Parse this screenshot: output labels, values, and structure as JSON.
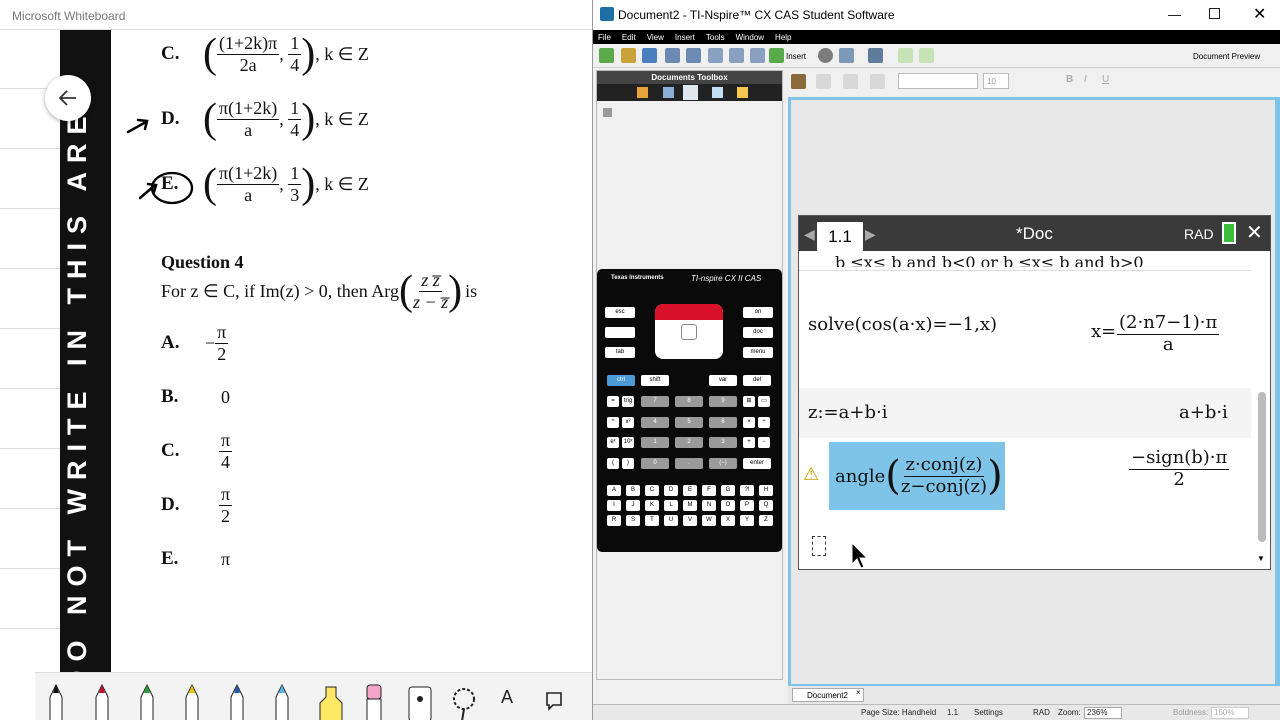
{
  "whiteboard": {
    "title": "Microsoft Whiteboard",
    "band_text": "DO NOT WRITE IN THIS AREA",
    "options_top": [
      {
        "letter": "C.",
        "num": "(1+2k)π",
        "den": "2a",
        "num2": "1",
        "den2": "4",
        "tail": ", k ∈ Z"
      },
      {
        "letter": "D.",
        "num": "π(1+2k)",
        "den": "a",
        "num2": "1",
        "den2": "4",
        "tail": ", k ∈ Z"
      },
      {
        "letter": "E.",
        "num": "π(1+2k)",
        "den": "a",
        "num2": "1",
        "den2": "3",
        "tail": ", k ∈ Z"
      }
    ],
    "question_title": "Question 4",
    "question_pre": "For z ∈ C, if Im(z) > 0, then Arg",
    "question_frac_num": "z z̅",
    "question_frac_den": "z − z̅",
    "question_post": "is",
    "answers": [
      {
        "letter": "A.",
        "prefix": "−",
        "num": "π",
        "den": "2"
      },
      {
        "letter": "B.",
        "value": "0"
      },
      {
        "letter": "C.",
        "num": "π",
        "den": "4"
      },
      {
        "letter": "D.",
        "num": "π",
        "den": "2"
      },
      {
        "letter": "E.",
        "value": "π"
      }
    ]
  },
  "ti": {
    "title": "Document2 - TI-Nspire™ CX CAS Student Software",
    "menu": [
      "File",
      "Edit",
      "View",
      "Insert",
      "Tools",
      "Window",
      "Help"
    ],
    "insert_label": "Insert",
    "doc_preview": "Document Preview",
    "font_size": "10",
    "toolbox_title": "Documents Toolbox",
    "brand": "Texas Instruments",
    "model": "TI-nspire CX II CAS",
    "page_tab": "1.1",
    "doc_name": "*Doc",
    "mode": "RAD",
    "top_partial": "b ≤x≤ b and b<0 or b ≤x≤ b and b>0",
    "entries": [
      {
        "input": "solve(cos(a·x)=−1,x)",
        "out_pre": "x=",
        "out_num": "(2·n7−1)·π",
        "out_den": "a"
      },
      {
        "input": "z:=a+b·i",
        "out": "a+b·i"
      },
      {
        "input_func": "angle",
        "input_num": "z·conj(z)",
        "input_den": "z−conj(z)",
        "out_num": "−sign(b)·π",
        "out_den": "2"
      }
    ],
    "doc_tab": "Document2",
    "status": {
      "page_size": "Page Size: Handheld",
      "page": "1.1",
      "settings": "Settings",
      "mode": "RAD",
      "zoom_label": "Zoom:",
      "zoom": "236%",
      "boldness": "Boldness:",
      "boldness_val": "150%"
    },
    "keys_top": [
      "esc",
      "on",
      "doc",
      "menu",
      "tab",
      "ctrl",
      "shift",
      "var",
      "del"
    ],
    "digits": [
      "7",
      "8",
      "9",
      "4",
      "5",
      "6",
      "1",
      "2",
      "3",
      "0",
      ".",
      "(−)"
    ],
    "letters": [
      "A",
      "B",
      "C",
      "D",
      "E",
      "F",
      "G",
      "?!",
      "H",
      "I",
      "J",
      "K",
      "L",
      "M",
      "N",
      "O",
      "P",
      "Q",
      "R",
      "S",
      "T",
      "U",
      "V",
      "W",
      "X",
      "Y",
      "Z"
    ],
    "enter": "enter"
  },
  "colors": {
    "band": "#111111",
    "accent": "#7ec4e8",
    "highlight": "#7ec4e8"
  }
}
